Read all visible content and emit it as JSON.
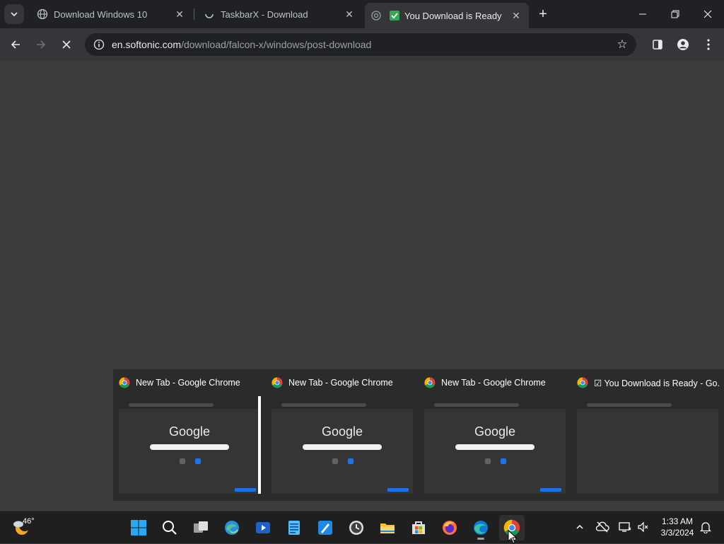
{
  "tabs": [
    {
      "title": "Download Windows 10",
      "active": false,
      "favicon": "globe-icon"
    },
    {
      "title": "TaskbarX - Download",
      "active": false,
      "favicon": "loading-spinner-icon"
    },
    {
      "title": "You Download is Ready",
      "active": true,
      "favicon": "green-check-icon"
    }
  ],
  "toolbar": {
    "url_host": "en.softonic.com",
    "url_path": "/download/falcon-x/windows/post-download"
  },
  "thumbnails": [
    {
      "title": "New Tab - Google Chrome",
      "content": "Google",
      "selected": true
    },
    {
      "title": "New Tab - Google Chrome",
      "content": "Google",
      "selected": false
    },
    {
      "title": "New Tab - Google Chrome",
      "content": "Google",
      "selected": false
    },
    {
      "title": "☑ You Download is Ready - Go...",
      "content": "",
      "selected": false
    }
  ],
  "taskbar": {
    "weather_temp": "46°",
    "clock_time": "1:33 AM",
    "clock_date": "3/3/2024",
    "apps": [
      "windows-start-icon",
      "search-icon",
      "task-view-icon",
      "edge-browser-icon",
      "media-player-icon",
      "notepad-icon",
      "paint-icon",
      "clock-app-icon",
      "file-explorer-icon",
      "microsoft-store-icon",
      "firefox-icon",
      "edge-icon",
      "chrome-icon"
    ]
  },
  "colors": {
    "tabstrip": "#202124",
    "toolbar": "#35363a",
    "page_bg": "#3c3c3c",
    "taskbar": "#1f1f1f",
    "accent_blue": "#1a73e8"
  }
}
